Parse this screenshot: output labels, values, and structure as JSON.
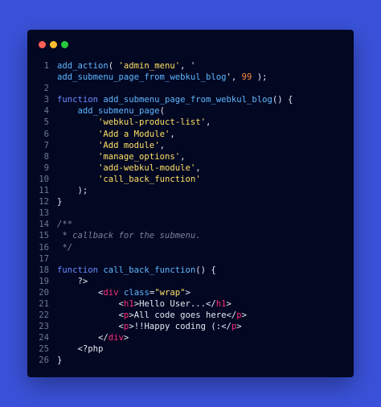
{
  "colors": {
    "background": "#3a52d9",
    "window": "#020722",
    "close": "#ff5f56",
    "minimize": "#ffbd2e",
    "maximize": "#27c93f",
    "line_number": "#6e7a92",
    "plain": "#e6e9f2",
    "function_name": "#5fb7ff",
    "keyword": "#6b8cff",
    "string": "#ffe066",
    "number": "#ff8b3d",
    "comment": "#7a8399",
    "tag": "#ff2e7a",
    "attribute": "#5fb7ff"
  },
  "window_controls": [
    {
      "name": "close",
      "color": "#ff5f56"
    },
    {
      "name": "minimize",
      "color": "#ffbd2e"
    },
    {
      "name": "maximize",
      "color": "#27c93f"
    }
  ],
  "code_lines": [
    {
      "n": "1",
      "tokens": [
        {
          "t": "add_action",
          "k": "function_name"
        },
        {
          "t": "( ",
          "k": "plain"
        },
        {
          "t": "'admin_menu'",
          "k": "string"
        },
        {
          "t": ", '",
          "k": "plain"
        }
      ]
    },
    {
      "n": "",
      "tokens": [
        {
          "t": "add_submenu_page_from_webkul_blog",
          "k": "function_name"
        },
        {
          "t": "', ",
          "k": "plain"
        },
        {
          "t": "99",
          "k": "number"
        },
        {
          "t": " );",
          "k": "plain"
        }
      ]
    },
    {
      "n": "2",
      "tokens": []
    },
    {
      "n": "3",
      "tokens": [
        {
          "t": "function ",
          "k": "keyword"
        },
        {
          "t": "add_submenu_page_from_webkul_blog",
          "k": "function_name"
        },
        {
          "t": "() {",
          "k": "plain"
        }
      ]
    },
    {
      "n": "4",
      "tokens": [
        {
          "t": "    ",
          "k": "plain"
        },
        {
          "t": "add_submenu_page",
          "k": "function_name"
        },
        {
          "t": "(",
          "k": "plain"
        }
      ]
    },
    {
      "n": "5",
      "tokens": [
        {
          "t": "        ",
          "k": "plain"
        },
        {
          "t": "'webkul-product-list'",
          "k": "string"
        },
        {
          "t": ",",
          "k": "plain"
        }
      ]
    },
    {
      "n": "6",
      "tokens": [
        {
          "t": "        ",
          "k": "plain"
        },
        {
          "t": "'Add a Module'",
          "k": "string"
        },
        {
          "t": ",",
          "k": "plain"
        }
      ]
    },
    {
      "n": "7",
      "tokens": [
        {
          "t": "        ",
          "k": "plain"
        },
        {
          "t": "'Add module'",
          "k": "string"
        },
        {
          "t": ",",
          "k": "plain"
        }
      ]
    },
    {
      "n": "8",
      "tokens": [
        {
          "t": "        ",
          "k": "plain"
        },
        {
          "t": "'manage_options'",
          "k": "string"
        },
        {
          "t": ",",
          "k": "plain"
        }
      ]
    },
    {
      "n": "9",
      "tokens": [
        {
          "t": "        ",
          "k": "plain"
        },
        {
          "t": "'add-webkul-module'",
          "k": "string"
        },
        {
          "t": ",",
          "k": "plain"
        }
      ]
    },
    {
      "n": "10",
      "tokens": [
        {
          "t": "        ",
          "k": "plain"
        },
        {
          "t": "'call_back_function'",
          "k": "string"
        }
      ]
    },
    {
      "n": "11",
      "tokens": [
        {
          "t": "    );",
          "k": "plain"
        }
      ]
    },
    {
      "n": "12",
      "tokens": [
        {
          "t": "}",
          "k": "plain"
        }
      ]
    },
    {
      "n": "13",
      "tokens": []
    },
    {
      "n": "14",
      "tokens": [
        {
          "t": "/**",
          "k": "comment"
        }
      ]
    },
    {
      "n": "15",
      "tokens": [
        {
          "t": " * callback for the submenu.",
          "k": "comment"
        }
      ]
    },
    {
      "n": "16",
      "tokens": [
        {
          "t": " */",
          "k": "comment"
        }
      ]
    },
    {
      "n": "17",
      "tokens": []
    },
    {
      "n": "18",
      "tokens": [
        {
          "t": "function ",
          "k": "keyword"
        },
        {
          "t": "call_back_function",
          "k": "function_name"
        },
        {
          "t": "() {",
          "k": "plain"
        }
      ]
    },
    {
      "n": "19",
      "tokens": [
        {
          "t": "    ?>",
          "k": "plain"
        }
      ]
    },
    {
      "n": "20",
      "tokens": [
        {
          "t": "        <",
          "k": "plain"
        },
        {
          "t": "div",
          "k": "tag"
        },
        {
          "t": " ",
          "k": "plain"
        },
        {
          "t": "class",
          "k": "attribute"
        },
        {
          "t": "=",
          "k": "plain"
        },
        {
          "t": "\"wrap\"",
          "k": "string"
        },
        {
          "t": ">",
          "k": "plain"
        }
      ]
    },
    {
      "n": "21",
      "tokens": [
        {
          "t": "            <",
          "k": "plain"
        },
        {
          "t": "h1",
          "k": "tag"
        },
        {
          "t": ">Hello User...</",
          "k": "plain"
        },
        {
          "t": "h1",
          "k": "tag"
        },
        {
          "t": ">",
          "k": "plain"
        }
      ]
    },
    {
      "n": "22",
      "tokens": [
        {
          "t": "            <",
          "k": "plain"
        },
        {
          "t": "p",
          "k": "tag"
        },
        {
          "t": ">All code goes here</",
          "k": "plain"
        },
        {
          "t": "p",
          "k": "tag"
        },
        {
          "t": ">",
          "k": "plain"
        }
      ]
    },
    {
      "n": "23",
      "tokens": [
        {
          "t": "            <",
          "k": "plain"
        },
        {
          "t": "p",
          "k": "tag"
        },
        {
          "t": ">!!Happy coding (:</",
          "k": "plain"
        },
        {
          "t": "p",
          "k": "tag"
        },
        {
          "t": ">",
          "k": "plain"
        }
      ]
    },
    {
      "n": "24",
      "tokens": [
        {
          "t": "        </",
          "k": "plain"
        },
        {
          "t": "div",
          "k": "tag"
        },
        {
          "t": ">",
          "k": "plain"
        }
      ]
    },
    {
      "n": "25",
      "tokens": [
        {
          "t": "    <?php",
          "k": "plain"
        }
      ]
    },
    {
      "n": "26",
      "tokens": [
        {
          "t": "}",
          "k": "plain"
        }
      ]
    }
  ]
}
